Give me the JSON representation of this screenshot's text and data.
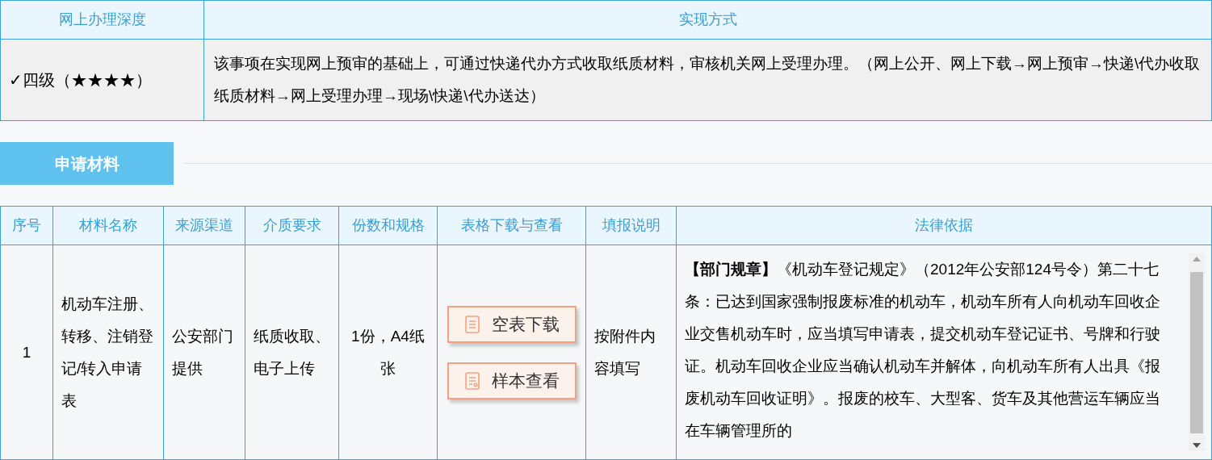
{
  "depth_table": {
    "columns": [
      "网上办理深度",
      "实现方式"
    ],
    "rows": [
      {
        "level": "✓四级（★★★★）",
        "method": "该事项在实现网上预审的基础上，可通过快递代办方式收取纸质材料，审核机关网上受理办理。（网上公开、网上下载→网上预审→快递\\代办收取纸质材料→网上受理办理→现场\\快递\\代办送达）"
      }
    ]
  },
  "section": {
    "title": "申请材料"
  },
  "materials_table": {
    "columns": [
      "序号",
      "材料名称",
      "来源渠道",
      "介质要求",
      "份数和规格",
      "表格下载与查看",
      "填报说明",
      "法律依据"
    ],
    "rows": [
      {
        "index": "1",
        "name": "机动车注册、转移、注销登记/转入申请表",
        "source": "公安部门提供",
        "medium": "纸质收取、电子上传",
        "spec": "1份，A4纸张",
        "buttons": [
          {
            "kind": "download",
            "label": "空表下载"
          },
          {
            "kind": "view",
            "label": "样本查看"
          }
        ],
        "instructions": "按附件内容填写",
        "legal_basis": "**【部门规章】**《机动车登记规定》（2012年公安部124号令）第二十七条：已达到国家强制报废标准的机动车，机动车所有人向机动车回收企业交售机动车时，应当填写申请表，提交机动车登记证书、号牌和行驶证。机动车回收企业应当确认机动车并解体，向机动车所有人出具《报废机动车回收证明》。报废的校车、大型客、货车及其他营运车辆应当在车辆管理所的"
      }
    ]
  }
}
